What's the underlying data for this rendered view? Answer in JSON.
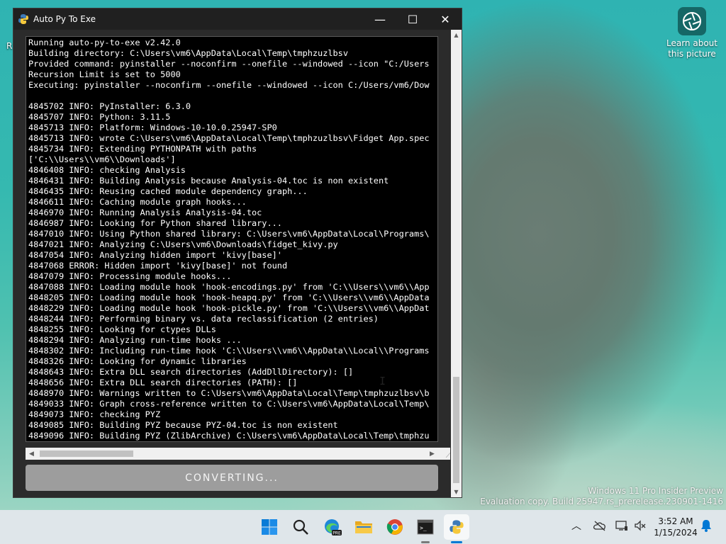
{
  "desktop": {
    "icon_label": "Learn about this picture",
    "partial_label": "R",
    "watermark_line1": "Windows 11 Pro Insider Preview",
    "watermark_line2": "Evaluation copy. Build 25947.rs_prerelease.230901-1416"
  },
  "window": {
    "title": "Auto Py To Exe",
    "minimize_glyph": "—",
    "maximize_glyph": "☐",
    "close_glyph": "✕"
  },
  "console": {
    "top_fragment": "'",
    "lines": [
      "Running auto-py-to-exe v2.42.0",
      "Building directory: C:\\Users\\vm6\\AppData\\Local\\Temp\\tmphzuzlbsv",
      "Provided command: pyinstaller --noconfirm --onefile --windowed --icon \"C:/Users",
      "Recursion Limit is set to 5000",
      "Executing: pyinstaller --noconfirm --onefile --windowed --icon C:/Users/vm6/Dow",
      "",
      "4845702 INFO: PyInstaller: 6.3.0",
      "4845707 INFO: Python: 3.11.5",
      "4845713 INFO: Platform: Windows-10-10.0.25947-SP0",
      "4845713 INFO: wrote C:\\Users\\vm6\\AppData\\Local\\Temp\\tmphzuzlbsv\\Fidget App.spec",
      "4845734 INFO: Extending PYTHONPATH with paths",
      "['C:\\\\Users\\\\vm6\\\\Downloads']",
      "4846408 INFO: checking Analysis",
      "4846431 INFO: Building Analysis because Analysis-04.toc is non existent",
      "4846435 INFO: Reusing cached module dependency graph...",
      "4846611 INFO: Caching module graph hooks...",
      "4846970 INFO: Running Analysis Analysis-04.toc",
      "4846987 INFO: Looking for Python shared library...",
      "4847010 INFO: Using Python shared library: C:\\Users\\vm6\\AppData\\Local\\Programs\\",
      "4847021 INFO: Analyzing C:\\Users\\vm6\\Downloads\\fidget_kivy.py",
      "4847054 INFO: Analyzing hidden import 'kivy[base]'",
      "4847068 ERROR: Hidden import 'kivy[base]' not found",
      "4847079 INFO: Processing module hooks...",
      "4847088 INFO: Loading module hook 'hook-encodings.py' from 'C:\\\\Users\\\\vm6\\\\App",
      "4848205 INFO: Loading module hook 'hook-heapq.py' from 'C:\\\\Users\\\\vm6\\\\AppData",
      "4848229 INFO: Loading module hook 'hook-pickle.py' from 'C:\\\\Users\\\\vm6\\\\AppDat",
      "4848244 INFO: Performing binary vs. data reclassification (2 entries)",
      "4848255 INFO: Looking for ctypes DLLs",
      "4848294 INFO: Analyzing run-time hooks ...",
      "4848302 INFO: Including run-time hook 'C:\\\\Users\\\\vm6\\\\AppData\\\\Local\\\\Programs",
      "4848326 INFO: Looking for dynamic libraries",
      "4848643 INFO: Extra DLL search directories (AddDllDirectory): []",
      "4848656 INFO: Extra DLL search directories (PATH): []",
      "4848970 INFO: Warnings written to C:\\Users\\vm6\\AppData\\Local\\Temp\\tmphzuzlbsv\\b",
      "4849033 INFO: Graph cross-reference written to C:\\Users\\vm6\\AppData\\Local\\Temp\\",
      "4849073 INFO: checking PYZ",
      "4849085 INFO: Building PYZ because PYZ-04.toc is non existent",
      "4849096 INFO: Building PYZ (ZlibArchive) C:\\Users\\vm6\\AppData\\Local\\Temp\\tmphzu"
    ]
  },
  "convert_button": {
    "label": "CONVERTING..."
  },
  "taskbar": {
    "time": "3:52 AM",
    "date": "1/15/2024",
    "edge_badge": "PRE",
    "colors": {
      "accent": "#0078d4"
    }
  }
}
